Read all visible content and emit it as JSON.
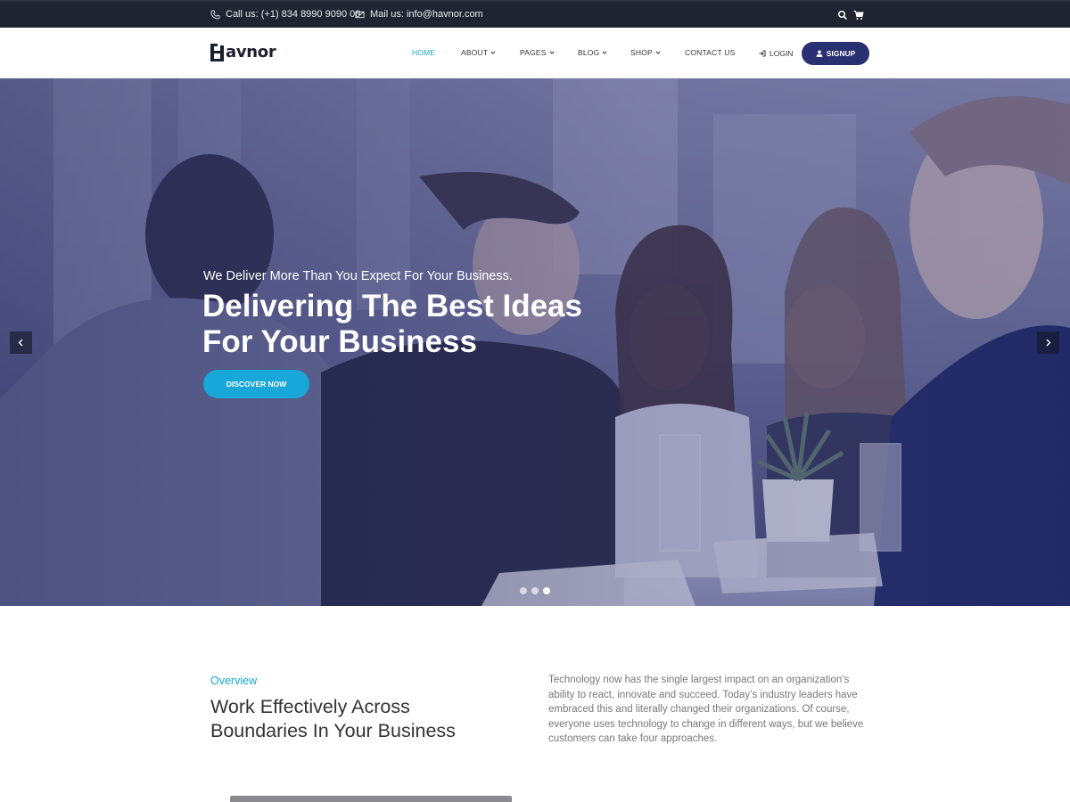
{
  "topbar": {
    "phone_text": "Call us: (+1) 834 8990 9090 00",
    "mail_text": "Mail us: info@havnor.com",
    "icons": [
      "phone-icon",
      "mail-icon",
      "search-icon",
      "cart-icon"
    ]
  },
  "header": {
    "logo_text": "avnor",
    "nav": [
      {
        "label": "HOME",
        "active": true
      },
      {
        "label": "ABOUT",
        "dropdown": true
      },
      {
        "label": "PAGES",
        "dropdown": true
      },
      {
        "label": "BLOG",
        "dropdown": true
      },
      {
        "label": "SHOP",
        "dropdown": true
      },
      {
        "label": "CONTACT US"
      }
    ],
    "login_label": "LOGIN",
    "signup_label": "SIGNUP"
  },
  "hero": {
    "subtitle": "We Deliver More Than You Expect For Your Business.",
    "title_line1": "Delivering The Best Ideas",
    "title_line2": "For Your Business",
    "cta_label": "DISCOVER NOW",
    "slides_total": 3,
    "active_slide": 3
  },
  "overview": {
    "label": "Overview",
    "title_line1": "Work Effectively Across",
    "title_line2": "Boundaries In Your Business",
    "text": "Technology now has the single largest impact on an organization’s ability to react, innovate and succeed. Today’s industry leaders have embraced this and literally changed their organizations. Of course, everyone uses technology to change in different ways, but we believe customers can take four approaches."
  },
  "colors": {
    "accent": "#18a7d8",
    "brand": "#283071",
    "topbar": "#1f2430"
  }
}
